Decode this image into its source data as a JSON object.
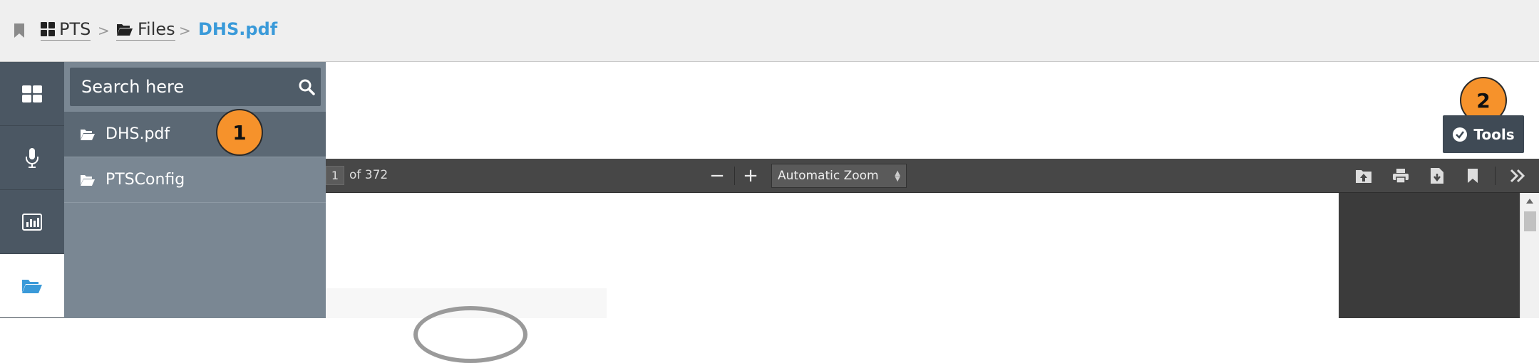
{
  "breadcrumb": {
    "items": [
      {
        "label": "PTS",
        "icon": "grid-icon"
      },
      {
        "label": "Files",
        "icon": "folder-open-icon"
      }
    ],
    "current": "DHS.pdf",
    "separator": ">"
  },
  "rail": {
    "items": [
      {
        "name": "dashboard",
        "icon": "grid-icon",
        "active": false
      },
      {
        "name": "audio",
        "icon": "microphone-icon",
        "active": false
      },
      {
        "name": "reports",
        "icon": "chart-icon",
        "active": false
      },
      {
        "name": "files",
        "icon": "folder-open-icon",
        "active": true
      }
    ]
  },
  "files_panel": {
    "search_placeholder": "Search here",
    "items": [
      {
        "label": "DHS.pdf",
        "selected": true
      },
      {
        "label": "PTSConfig",
        "selected": false
      }
    ]
  },
  "callouts": [
    "1",
    "2"
  ],
  "tools": {
    "label": "Tools"
  },
  "pdf_toolbar": {
    "page_number": "1",
    "page_of": "of 372",
    "zoom_out": "−",
    "zoom_in": "+",
    "zoom_value": "Automatic Zoom"
  },
  "colors": {
    "accent": "#3a9ad9",
    "rail_bg": "#4b5763",
    "panel_bg": "#7a8793",
    "badge": "#f6922b",
    "toolbar_bg": "#474747"
  }
}
